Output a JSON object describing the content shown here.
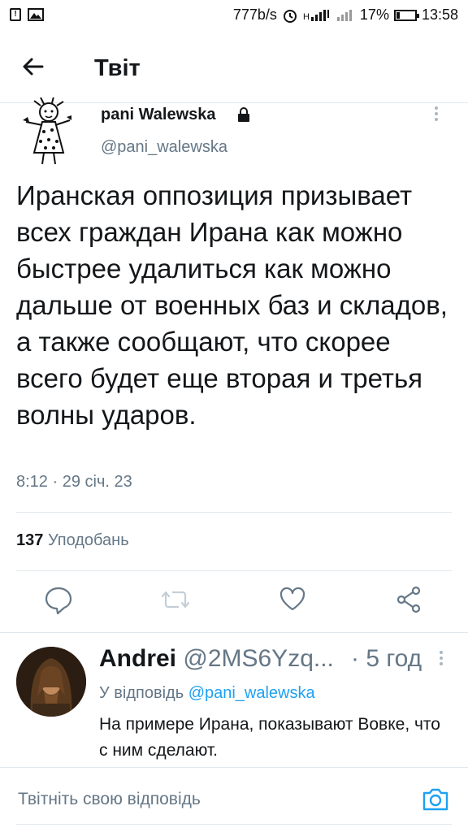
{
  "status_bar": {
    "net_speed": "777b/s",
    "battery": "17%",
    "battery_level": 0.17,
    "time": "13:58"
  },
  "header": {
    "title": "Твіт"
  },
  "tweet": {
    "author_name": "pani Walewska",
    "handle": "@pani_walewska",
    "text": "Иранская оппозиция призывает всех граждан Ирана как можно быстрее удалиться как можно дальше от военных баз и складов, а также сообщают, что скорее всего будет еще вторая и третья волны ударов.",
    "timestamp": "8:12 · 29 січ. 23",
    "likes_count": "137",
    "likes_label": "Уподобань"
  },
  "reply": {
    "name": "Andrei",
    "handle": "@2MS6Yzq...",
    "time": "· 5 год",
    "reply_to_label": "У відповідь",
    "reply_to_handle": "@pani_walewska",
    "text": "На примере Ирана, показывают Вовке, что с ним сделают."
  },
  "compose": {
    "placeholder": "Твітніть свою відповідь"
  },
  "colors": {
    "accent": "#1da1f2",
    "secondary_text": "#657786",
    "divider": "#e1e8ed"
  },
  "icons": [
    "back-arrow-icon",
    "lock-icon",
    "reply-icon",
    "retweet-icon",
    "like-icon",
    "share-icon",
    "camera-icon",
    "more-icon"
  ]
}
